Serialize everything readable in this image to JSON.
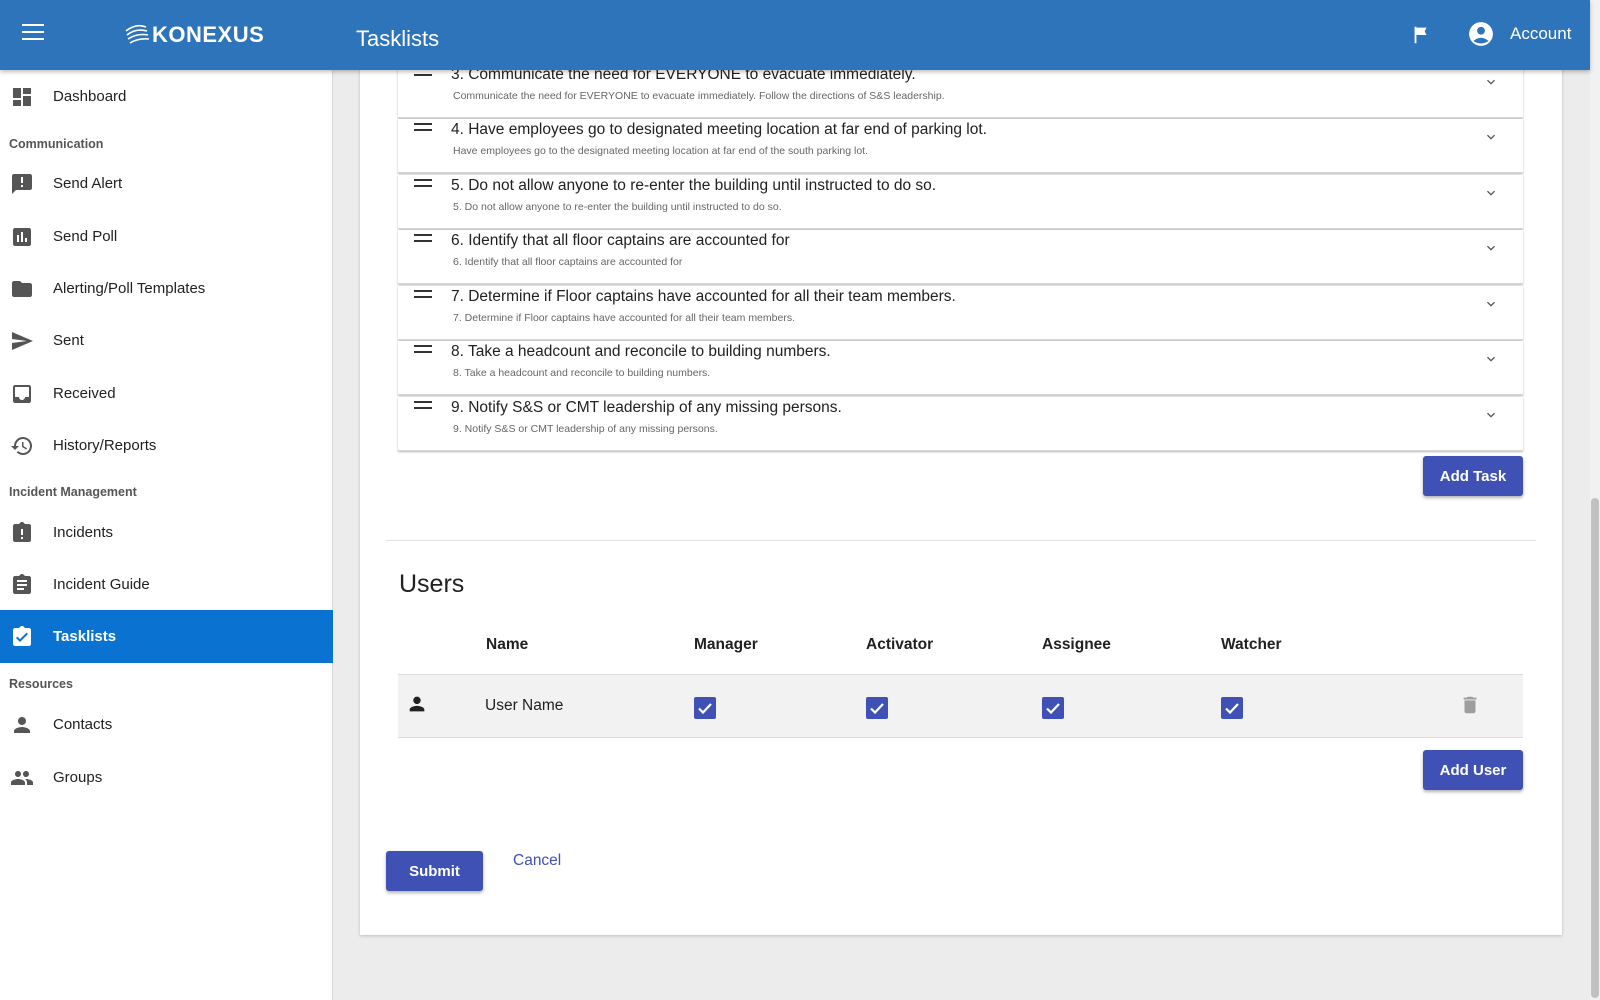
{
  "app": {
    "logo_text": "KONEXUS",
    "page_title": "Tasklists",
    "account_label": "Account",
    "icons": {
      "menu": "menu-icon",
      "flag": "flag-icon",
      "account": "account-circle-icon"
    }
  },
  "sidebar": {
    "items": [
      {
        "label": "Dashboard",
        "icon": "dashboard-icon"
      },
      {
        "label": "Send Alert",
        "icon": "alert-message-icon"
      },
      {
        "label": "Send Poll",
        "icon": "poll-icon"
      },
      {
        "label": "Alerting/Poll Templates",
        "icon": "folder-icon"
      },
      {
        "label": "Sent",
        "icon": "send-icon"
      },
      {
        "label": "Received",
        "icon": "inbox-icon"
      },
      {
        "label": "History/Reports",
        "icon": "history-icon"
      },
      {
        "label": "Incidents",
        "icon": "incident-icon"
      },
      {
        "label": "Incident Guide",
        "icon": "clipboard-icon"
      },
      {
        "label": "Tasklists",
        "icon": "clipboard-check-icon",
        "active": true
      },
      {
        "label": "Contacts",
        "icon": "person-icon"
      },
      {
        "label": "Groups",
        "icon": "people-icon"
      }
    ],
    "sections": {
      "communication": "Communication",
      "incident_management": "Incident Management",
      "resources": "Resources"
    }
  },
  "tasks": [
    {
      "title": "3. Communicate the need for EVERYONE to evacuate immediately.",
      "description": "Communicate the need for EVERYONE to evacuate immediately. Follow the directions of S&S leadership."
    },
    {
      "title": "4. Have employees go to designated meeting location at far end of parking lot.",
      "description": "Have employees go to the designated meeting location at far end of the south parking lot."
    },
    {
      "title": "5. Do not allow anyone to re-enter the building until instructed to do so.",
      "description": "5. Do not allow anyone to re-enter the building until instructed to do so."
    },
    {
      "title": "6. Identify that all floor captains are accounted for",
      "description": "6. Identify that all floor captains are accounted for"
    },
    {
      "title": "7. Determine if Floor captains have accounted for all their team members.",
      "description": "7. Determine if Floor captains have accounted for all their team members."
    },
    {
      "title": "8. Take a headcount and reconcile to building numbers.",
      "description": "8. Take a headcount and reconcile to building numbers."
    },
    {
      "title": "9. Notify S&S or CMT leadership of any missing persons.",
      "description": "9. Notify S&S or CMT leadership of any missing persons."
    }
  ],
  "add_task_label": "Add Task",
  "users": {
    "heading": "Users",
    "columns": [
      "Name",
      "Manager",
      "Activator",
      "Assignee",
      "Watcher"
    ],
    "rows": [
      {
        "name": "User Name",
        "manager": true,
        "activator": true,
        "assignee": true,
        "watcher": true
      }
    ],
    "add_user_label": "Add User"
  },
  "form": {
    "submit_label": "Submit",
    "cancel_label": "Cancel"
  },
  "colors": {
    "topbar": "#2e74bb",
    "active_nav": "#0a73d2",
    "primary": "#3f51b5"
  }
}
